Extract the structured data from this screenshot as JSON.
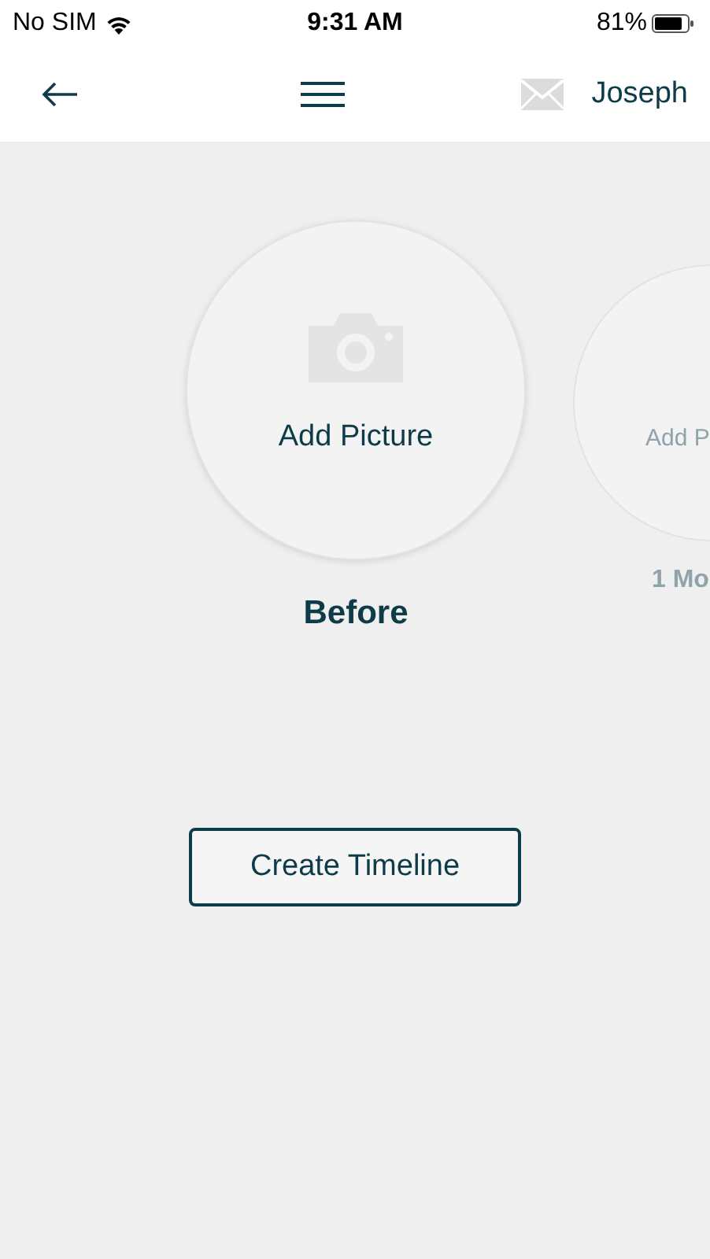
{
  "status_bar": {
    "carrier": "No SIM",
    "time": "9:31 AM",
    "battery": "81%"
  },
  "nav": {
    "user": "Joseph"
  },
  "slides": [
    {
      "action": "Add Picture",
      "label": "Before",
      "selected": true
    },
    {
      "action": "Add P",
      "label": "1 Mo",
      "selected": false
    }
  ],
  "button": "Create Timeline"
}
